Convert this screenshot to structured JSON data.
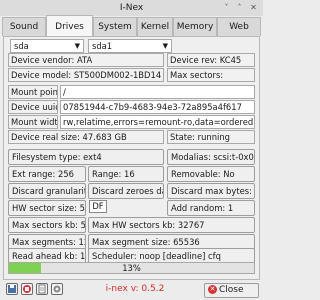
{
  "window": {
    "title": "I-Nex",
    "minimize": "˅",
    "maximize": "˄",
    "close": "✕"
  },
  "tabs": [
    "Sound",
    "Drives",
    "System",
    "Kernel",
    "Memory",
    "Web"
  ],
  "active_tab": "Drives",
  "selectors": {
    "drive": "sda",
    "partition": "sda1"
  },
  "fields": {
    "vendor": "Device vendor: ATA",
    "rev": "Device rev: KC45",
    "model": "Device model: ST500DM002-1BD14",
    "max_sectors": "Max sectors:",
    "mount_point_label": "Mount poin",
    "mount_point_value": "/",
    "uuid_label": "Device uuid",
    "uuid_value": "07851944-c7b9-4683-94e3-72a895a4f617",
    "mount_width_label": "Mount widt",
    "mount_width_value": "rw,relatime,errors=remount-ro,data=ordered",
    "real_size": "Device real size: 47.683 GB",
    "state": "State: running",
    "fs_type": "Filesystem type: ext4",
    "modalias": "Modalias: scsi:t-0x00",
    "ext_range": "Ext range: 256",
    "range": "Range: 16",
    "removable": "Removable: No",
    "discard_granularity": "Discard granularity",
    "discard_zeroes": "Discard zeroes da",
    "discard_max_bytes": "Discard max bytes: 0",
    "hw_sector": "HW sector size: 51",
    "add_random": "Add random: 1",
    "max_sectors_kb": "Max sectors kb: 51",
    "max_hw_sectors_kb": "Max HW sectors kb: 32767",
    "max_segments": "Max segments: 12",
    "max_segment_size": "Max segment size: 65536",
    "read_ahead": "Read ahead kb: 12",
    "scheduler": "Scheduler: noop [deadline] cfq"
  },
  "tooltip": "DF",
  "progress": {
    "percent": 13,
    "label": "13%",
    "color": "#7fd152"
  },
  "bottom": {
    "icons": [
      "save-icon",
      "stop-icon",
      "report-icon",
      "settings-icon"
    ],
    "version": "i-nex v: 0.5.2",
    "close_label": "Close"
  }
}
